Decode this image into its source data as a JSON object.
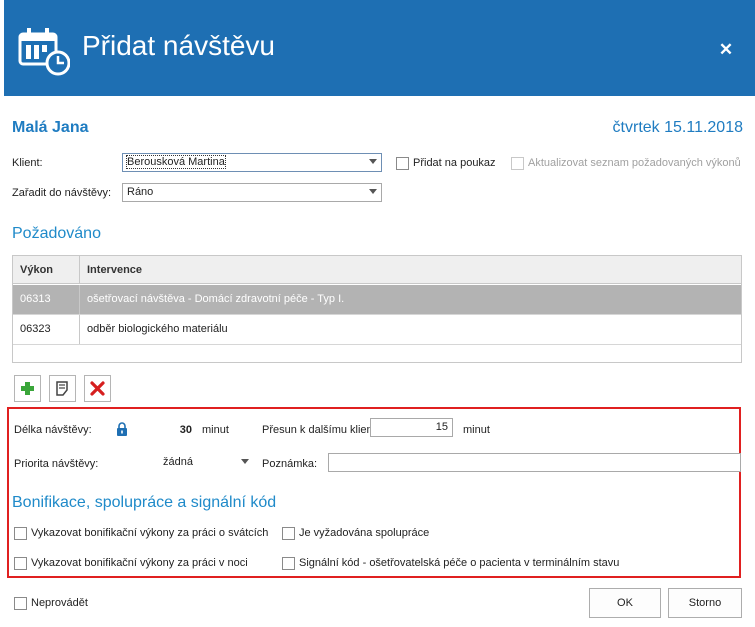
{
  "header": {
    "title": "Přidat návštěvu",
    "close_glyph": "✕",
    "icon": "calendar-clock-icon",
    "background": "#1e6fb3"
  },
  "visit": {
    "nurse_name": "Malá Jana",
    "date_label": "čtvrtek 15.11.2018"
  },
  "form": {
    "client_label": "Klient:",
    "client_value": "Berousková Martina",
    "assign_label": "Zařadit do návštěvy:",
    "assign_value": "Ráno",
    "voucher_label": "Přidat na poukaz",
    "update_list_label": "Aktualizovat seznam požadovaných výkonů"
  },
  "requested": {
    "title": "Požadováno",
    "columns": [
      "Výkon",
      "Intervence"
    ],
    "rows": [
      {
        "code": "06313",
        "intervention": "ošetřovací návštěva - Domácí zdravotní péče - Typ I.",
        "selected": true
      },
      {
        "code": "06323",
        "intervention": "odběr biologického materiálu",
        "selected": false
      }
    ],
    "toolbar": {
      "add_icon": "plus-icon",
      "edit_icon": "note-icon",
      "delete_icon": "delete-x-icon"
    }
  },
  "details": {
    "duration_label": "Délka návštěvy:",
    "duration_value": "30",
    "duration_unit": "minut",
    "transfer_label": "Přesun k dalšímu klientovi:",
    "transfer_value": "15",
    "transfer_unit": "minut",
    "priority_label": "Priorita návštěvy:",
    "priority_value": "žádná",
    "note_label": "Poznámka:",
    "note_value": ""
  },
  "bonus": {
    "title": "Bonifikace, spolupráce a signální kód",
    "holiday_label": "Vykazovat bonifikační výkony za práci o svátcích",
    "night_label": "Vykazovat bonifikační výkony za práci v noci",
    "cooperation_label": "Je vyžadována spolupráce",
    "signal_label": "Signální kód - ošetřovatelská péče o pacienta v terminálním stavu"
  },
  "footer": {
    "not_performed_label": "Neprovádět",
    "ok_label": "OK",
    "cancel_label": "Storno"
  },
  "colors": {
    "accent": "#1f8ac9",
    "highlight_frame": "#e02020",
    "selected_row": "#b3b3b3"
  }
}
